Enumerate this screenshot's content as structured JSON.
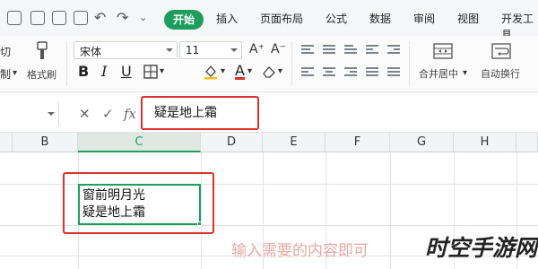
{
  "menu_tabs": {
    "start": "开始",
    "insert": "插入",
    "page_layout": "页面布局",
    "formulas": "公式",
    "data": "数据",
    "review": "审阅",
    "view": "视图",
    "developer": "开发工具"
  },
  "ribbon": {
    "cut_label": "切",
    "paste_label": "制",
    "format_painter": "格式刷",
    "font_name": "宋体",
    "font_size": "11",
    "grow_font": "A⁺",
    "shrink_font": "A⁻",
    "bold": "B",
    "italic": "I",
    "underline": "U",
    "font_color_glyph": "A",
    "merge_center": "合并居中",
    "wrap_text": "自动换行"
  },
  "formula_bar": {
    "cancel": "✕",
    "confirm": "✓",
    "fx": "fx",
    "value": "疑是地上霜"
  },
  "columns": [
    "B",
    "C",
    "D",
    "E",
    "F",
    "G",
    "H"
  ],
  "active_column": "C",
  "active_cell": {
    "line1": "窗前明月光",
    "line2": "疑是地上霜"
  },
  "annotation": "输入需要的内容即可",
  "watermark": "时空手游网",
  "colors": {
    "accent": "#1e9e5c",
    "highlight_box": "#d9322f",
    "hint_text": "#e9a8a4"
  }
}
